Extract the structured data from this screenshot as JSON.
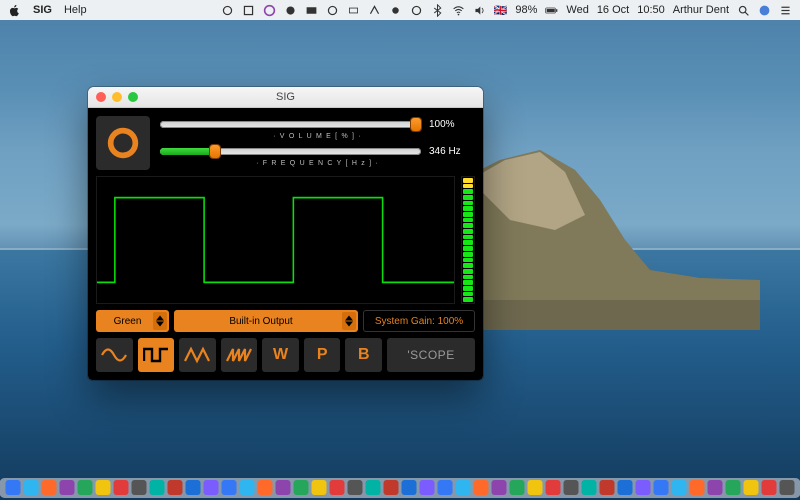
{
  "menubar": {
    "apple": "",
    "app": "SIG",
    "items": [
      "Help"
    ],
    "status": {
      "battery_pct": "98%",
      "flag": "🇬🇧",
      "day": "Wed",
      "date": "16 Oct",
      "time": "10:50",
      "user": "Arthur Dent"
    }
  },
  "window": {
    "title": "SIG"
  },
  "sliders": {
    "volume": {
      "label": "· V O L U M E  [ % ]  ·",
      "value_text": "100%",
      "pct": 100
    },
    "frequency": {
      "label": "· F R E Q U E N C Y  [ H z ]  ·",
      "value_text": "346 Hz",
      "pct": 21
    }
  },
  "controls": {
    "color_select": "Green",
    "output_select": "Built-in Output",
    "system_gain": "System Gain: 100%"
  },
  "buttons": {
    "scope": "'SCOPE",
    "w": "W",
    "p": "P",
    "b": "B"
  },
  "waveforms": {
    "sine": "sine",
    "square": "square",
    "triangle": "triangle",
    "saw": "saw"
  },
  "meter": {
    "segments": 22,
    "lit": 22
  },
  "colors": {
    "accent": "#e9831f",
    "scope_trace": "#0bdc0b"
  },
  "dock_icons": 44
}
